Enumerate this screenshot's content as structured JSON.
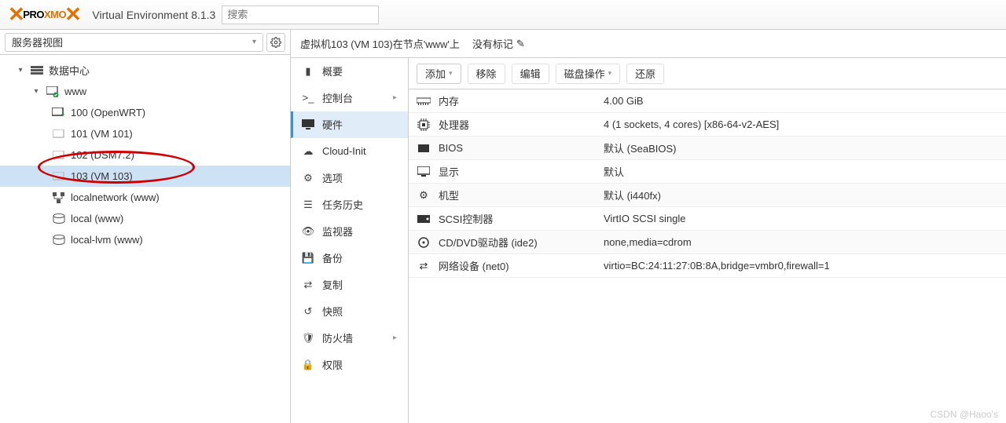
{
  "header": {
    "product": "PROXMOX",
    "ve_label": "Virtual Environment 8.1.3",
    "search_placeholder": "搜索"
  },
  "left": {
    "view_label": "服务器视图",
    "tree": {
      "root": "数据中心",
      "node": "www",
      "items": [
        {
          "label": "100 (OpenWRT)",
          "icon": "vm-run"
        },
        {
          "label": "101 (VM 101)",
          "icon": "vm"
        },
        {
          "label": "102 (DSM7.2)",
          "icon": "vm"
        },
        {
          "label": "103 (VM 103)",
          "icon": "vm",
          "selected": true
        },
        {
          "label": "localnetwork (www)",
          "icon": "net"
        },
        {
          "label": "local (www)",
          "icon": "storage"
        },
        {
          "label": "local-lvm (www)",
          "icon": "storage"
        }
      ]
    }
  },
  "content": {
    "title": "虚拟机103 (VM 103)在节点'www'上",
    "tags_label": "没有标记",
    "tabs": [
      {
        "label": "概要",
        "icon": "book"
      },
      {
        "label": "控制台",
        "icon": "terminal",
        "chev": true
      },
      {
        "label": "硬件",
        "icon": "monitor",
        "active": true
      },
      {
        "label": "Cloud-Init",
        "icon": "cloud"
      },
      {
        "label": "选项",
        "icon": "gear"
      },
      {
        "label": "任务历史",
        "icon": "list"
      },
      {
        "label": "监视器",
        "icon": "eye"
      },
      {
        "label": "备份",
        "icon": "save"
      },
      {
        "label": "复制",
        "icon": "copy"
      },
      {
        "label": "快照",
        "icon": "history"
      },
      {
        "label": "防火墙",
        "icon": "shield",
        "chev": true
      },
      {
        "label": "权限",
        "icon": "lock"
      }
    ],
    "toolbar": {
      "add": "添加",
      "remove": "移除",
      "edit": "编辑",
      "disk": "磁盘操作",
      "revert": "还原"
    },
    "hardware": [
      {
        "icon": "memory",
        "label": "内存",
        "value": "4.00 GiB"
      },
      {
        "icon": "cpu",
        "label": "处理器",
        "value": "4 (1 sockets, 4 cores) [x86-64-v2-AES]"
      },
      {
        "icon": "chip",
        "label": "BIOS",
        "value": "默认 (SeaBIOS)"
      },
      {
        "icon": "monitor",
        "label": "显示",
        "value": "默认"
      },
      {
        "icon": "gear",
        "label": "机型",
        "value": "默认 (i440fx)"
      },
      {
        "icon": "hdd",
        "label": "SCSI控制器",
        "value": "VirtIO SCSI single"
      },
      {
        "icon": "disc",
        "label": "CD/DVD驱动器 (ide2)",
        "value": "none,media=cdrom"
      },
      {
        "icon": "swap",
        "label": "网络设备 (net0)",
        "value": "virtio=BC:24:11:27:0B:8A,bridge=vmbr0,firewall=1"
      }
    ]
  },
  "watermark": "CSDN @Haoo's"
}
